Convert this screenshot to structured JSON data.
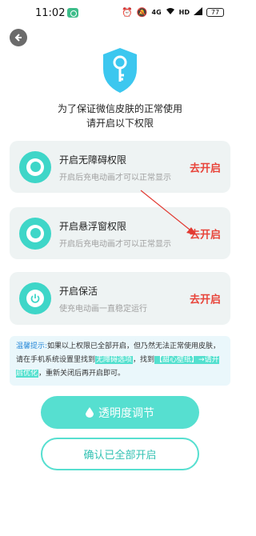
{
  "status_bar": {
    "time": "11:02",
    "icons": [
      "alarm-icon",
      "mute-icon",
      "network-icon",
      "wifi-icon",
      "hd-icon",
      "signal-icon"
    ],
    "network_label": "4G",
    "hd_label": "HD",
    "battery": "77"
  },
  "header": {
    "back_icon": "back-arrow-icon",
    "shield_icon": "key-shield-icon"
  },
  "intro": {
    "line1": "为了保证微信皮肤的正常使用",
    "line2": "请开启以下权限"
  },
  "permissions": [
    {
      "title": "开启无障碍权限",
      "subtitle": "开启后充电动画才可以正常显示",
      "action": "去开启",
      "icon": "toggle-circle-icon"
    },
    {
      "title": "开启悬浮窗权限",
      "subtitle": "开启后充电动画才可以正常显示",
      "action": "去开启",
      "icon": "toggle-circle-icon"
    },
    {
      "title": "开启保活",
      "subtitle": "使充电动画一直稳定运行",
      "action": "去开启",
      "icon": "power-icon"
    }
  ],
  "tip": {
    "label": "温馨提示:",
    "text1": "如果以上权限已全部开启，但乃然无法正常使用皮肤，请在手机系统设置里找到",
    "highlight1": "无障碍选项",
    "text2": "，找到",
    "highlight2": "【甜心壁纸】→请开启优化",
    "text3": "，重新关闭后再开启即可。"
  },
  "buttons": {
    "opacity_label": "透明度调节",
    "opacity_icon": "droplet-icon",
    "confirm_label": "确认已全部开启"
  },
  "colors": {
    "accent": "#56dfd0",
    "icon_bg": "#3ed6c8",
    "action_red": "#e8443a",
    "card_bg": "#eef3f3",
    "tip_bg": "#eaf7fb"
  }
}
